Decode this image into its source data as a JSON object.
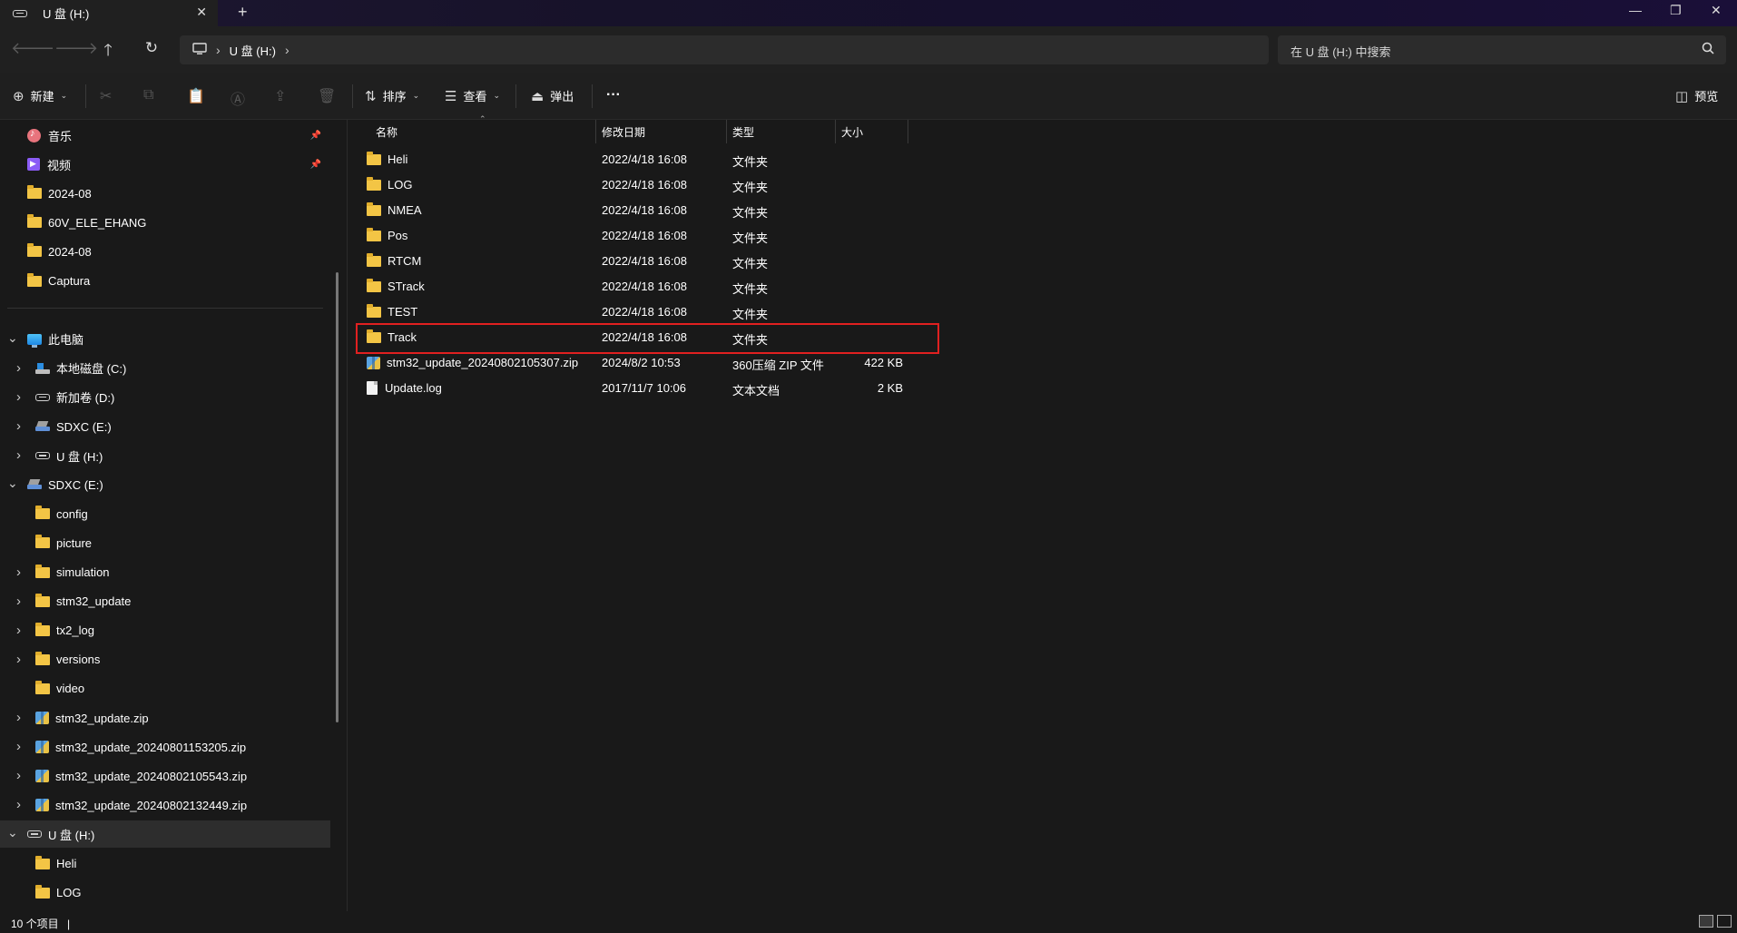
{
  "window": {
    "tab_title": "U 盘 (H:)",
    "tab_close": "✕",
    "new_tab": "+",
    "minimize": "—",
    "restore": "❐",
    "close": "✕"
  },
  "address": {
    "crumbs": [
      "U 盘 (H:)"
    ],
    "search_placeholder": "在 U 盘 (H:) 中搜索"
  },
  "toolbar": {
    "new_label": "新建",
    "sort_label": "排序",
    "view_label": "查看",
    "eject_label": "弹出",
    "more": "···",
    "preview_label": "预览"
  },
  "sidebar": {
    "quick": [
      {
        "label": "音乐",
        "icon": "music-icon",
        "pinned": true
      },
      {
        "label": "视频",
        "icon": "video-icon",
        "pinned": true
      },
      {
        "label": "2024-08",
        "icon": "folder-icon"
      },
      {
        "label": "60V_ELE_EHANG",
        "icon": "folder-icon"
      },
      {
        "label": "2024-08",
        "icon": "folder-icon"
      },
      {
        "label": "Captura",
        "icon": "folder-icon"
      }
    ],
    "this_pc": "此电脑",
    "drives": [
      {
        "label": "本地磁盘 (C:)",
        "icon": "local-disk-icon"
      },
      {
        "label": "新加卷 (D:)",
        "icon": "drive-icon"
      },
      {
        "label": "SDXC (E:)",
        "icon": "sdxc-icon"
      },
      {
        "label": "U 盘 (H:)",
        "icon": "drive-icon"
      }
    ],
    "sdxc_root": "SDXC (E:)",
    "sdxc_children": [
      {
        "label": "config",
        "icon": "folder-icon",
        "expandable": false
      },
      {
        "label": "picture",
        "icon": "folder-icon",
        "expandable": false
      },
      {
        "label": "simulation",
        "icon": "folder-icon",
        "expandable": true
      },
      {
        "label": "stm32_update",
        "icon": "folder-icon",
        "expandable": true
      },
      {
        "label": "tx2_log",
        "icon": "folder-icon",
        "expandable": true
      },
      {
        "label": "versions",
        "icon": "folder-icon",
        "expandable": true
      },
      {
        "label": "video",
        "icon": "folder-icon",
        "expandable": false
      },
      {
        "label": "stm32_update.zip",
        "icon": "zip-icon",
        "expandable": true
      },
      {
        "label": "stm32_update_20240801153205.zip",
        "icon": "zip-icon",
        "expandable": true
      },
      {
        "label": "stm32_update_20240802105543.zip",
        "icon": "zip-icon",
        "expandable": true
      },
      {
        "label": "stm32_update_20240802132449.zip",
        "icon": "zip-icon",
        "expandable": true
      }
    ],
    "udisk_root": "U 盘 (H:)",
    "udisk_children": [
      {
        "label": "Heli",
        "icon": "folder-icon"
      },
      {
        "label": "LOG",
        "icon": "folder-icon"
      }
    ]
  },
  "columns": {
    "name": "名称",
    "date": "修改日期",
    "type": "类型",
    "size": "大小"
  },
  "files": [
    {
      "name": "Heli",
      "date": "2022/4/18 16:08",
      "type": "文件夹",
      "size": "",
      "icon": "folder-icon"
    },
    {
      "name": "LOG",
      "date": "2022/4/18 16:08",
      "type": "文件夹",
      "size": "",
      "icon": "folder-icon"
    },
    {
      "name": "NMEA",
      "date": "2022/4/18 16:08",
      "type": "文件夹",
      "size": "",
      "icon": "folder-icon"
    },
    {
      "name": "Pos",
      "date": "2022/4/18 16:08",
      "type": "文件夹",
      "size": "",
      "icon": "folder-icon"
    },
    {
      "name": "RTCM",
      "date": "2022/4/18 16:08",
      "type": "文件夹",
      "size": "",
      "icon": "folder-icon"
    },
    {
      "name": "STrack",
      "date": "2022/4/18 16:08",
      "type": "文件夹",
      "size": "",
      "icon": "folder-icon"
    },
    {
      "name": "TEST",
      "date": "2022/4/18 16:08",
      "type": "文件夹",
      "size": "",
      "icon": "folder-icon"
    },
    {
      "name": "Track",
      "date": "2022/4/18 16:08",
      "type": "文件夹",
      "size": "",
      "icon": "folder-icon"
    },
    {
      "name": "stm32_update_20240802105307.zip",
      "date": "2024/8/2 10:53",
      "type": "360压缩 ZIP 文件",
      "size": "422 KB",
      "icon": "zip-icon"
    },
    {
      "name": "Update.log",
      "date": "2017/11/7 10:06",
      "type": "文本文档",
      "size": "2 KB",
      "icon": "document-icon"
    }
  ],
  "status": {
    "item_count": "10 个项目",
    "separator": "|"
  },
  "colors": {
    "highlight_border": "#e02020",
    "folder": "#f3c545",
    "background": "#191919"
  }
}
